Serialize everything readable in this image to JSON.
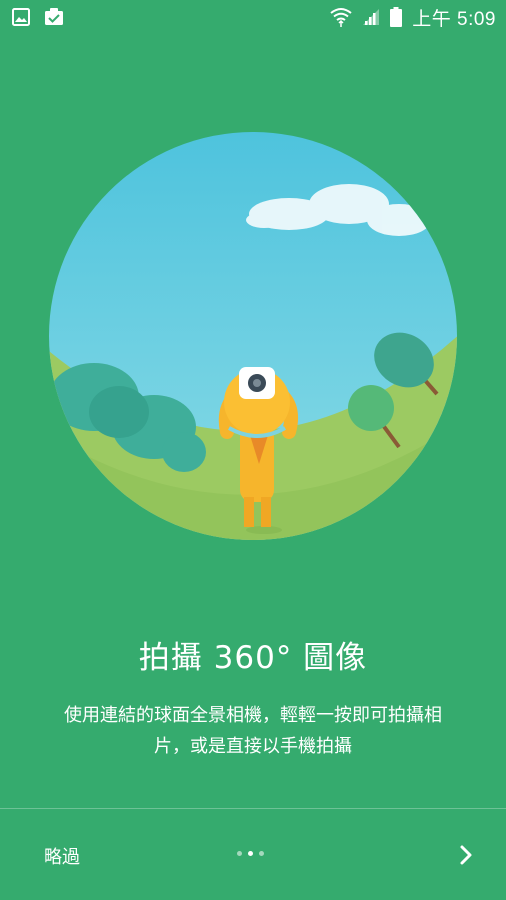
{
  "status_bar": {
    "time": "上午 5:09",
    "left_icons": [
      "image-icon",
      "clipboard-check-icon"
    ],
    "right_icons": [
      "wifi-icon",
      "signal-icon",
      "battery-icon"
    ]
  },
  "onboarding": {
    "title": "拍攝 360° 圖像",
    "description": "使用連結的球面全景相機，輕輕一按即可拍攝相片，或是直接以手機拍攝",
    "illustration": "person-taking-photo-with-360-camera"
  },
  "bottom_bar": {
    "skip_label": "略過",
    "page_count": 3,
    "active_page": 2,
    "next_icon": "chevron-right-icon"
  },
  "colors": {
    "background": "#35ab6e",
    "sky": "#6ccfe0",
    "grass": "#9cca62",
    "character": "#f6b52c"
  }
}
